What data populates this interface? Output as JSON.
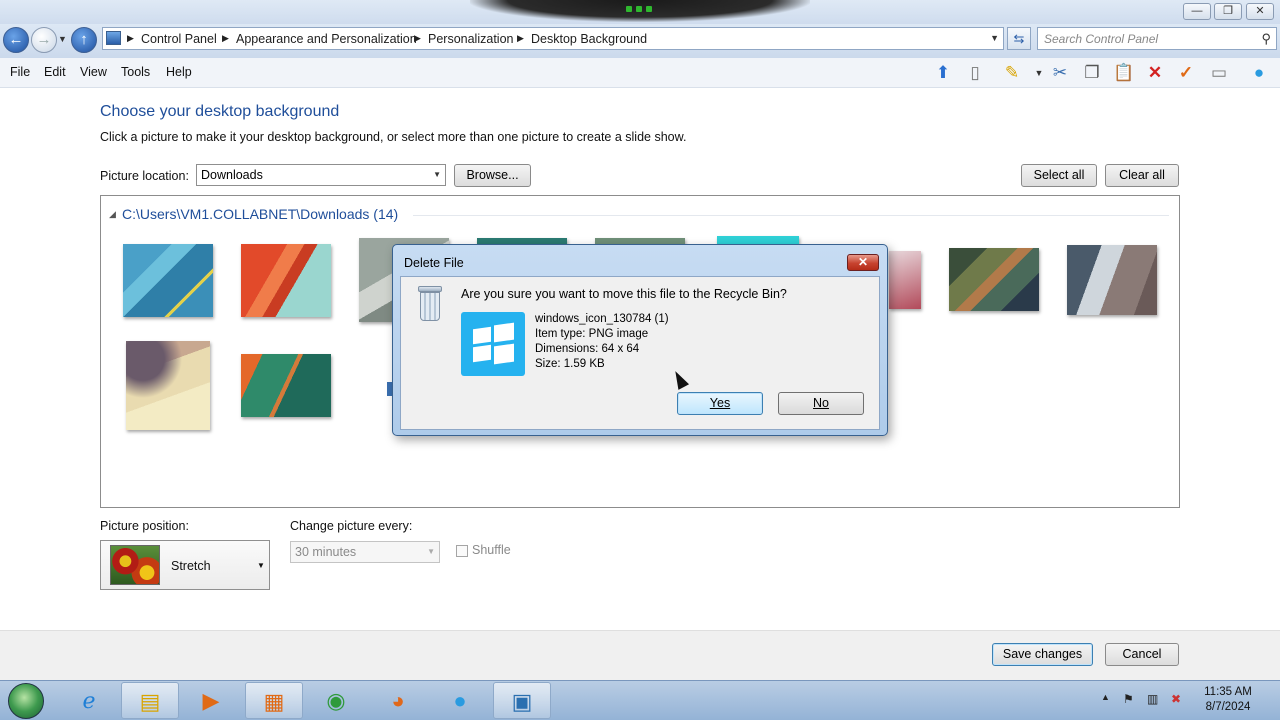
{
  "window": {
    "minimize_glyph": "—",
    "restore_glyph": "❐",
    "close_glyph": "✕"
  },
  "address": {
    "crumbs": [
      "Control Panel",
      "Appearance and Personalization",
      "Personalization",
      "Desktop Background"
    ],
    "search_placeholder": "Search Control Panel"
  },
  "menu": {
    "items": [
      "File",
      "Edit",
      "View",
      "Tools",
      "Help"
    ]
  },
  "page": {
    "title": "Choose your desktop background",
    "description": "Click a picture to make it your desktop background, or select more than one picture to create a slide show.",
    "location_label": "Picture location:",
    "location_value": "Downloads",
    "browse_label": "Browse...",
    "select_all_label": "Select all",
    "clear_all_label": "Clear all",
    "group_header": "C:\\Users\\VM1.COLLABNET\\Downloads (14)",
    "position_label": "Picture position:",
    "position_value": "Stretch",
    "change_label": "Change picture every:",
    "change_value": "30 minutes",
    "shuffle_label": "Shuffle",
    "save_label": "Save changes",
    "cancel_label": "Cancel"
  },
  "dialog": {
    "title": "Delete File",
    "close_glyph": "✕",
    "question": "Are you sure you want to move this file to the Recycle Bin?",
    "file_name": "windows_icon_130784 (1)",
    "item_type": "Item type: PNG image",
    "dimensions": "Dimensions: 64 x 64",
    "size": "Size: 1.59 KB",
    "yes_label": "Yes",
    "no_label": "No",
    "tile_color": "#25b2ef"
  },
  "taskbar": {
    "time": "11:35 AM",
    "date": "8/7/2024"
  },
  "colors": {
    "accent_heading": "#1f4e9a",
    "close_red": "#c7432f"
  }
}
